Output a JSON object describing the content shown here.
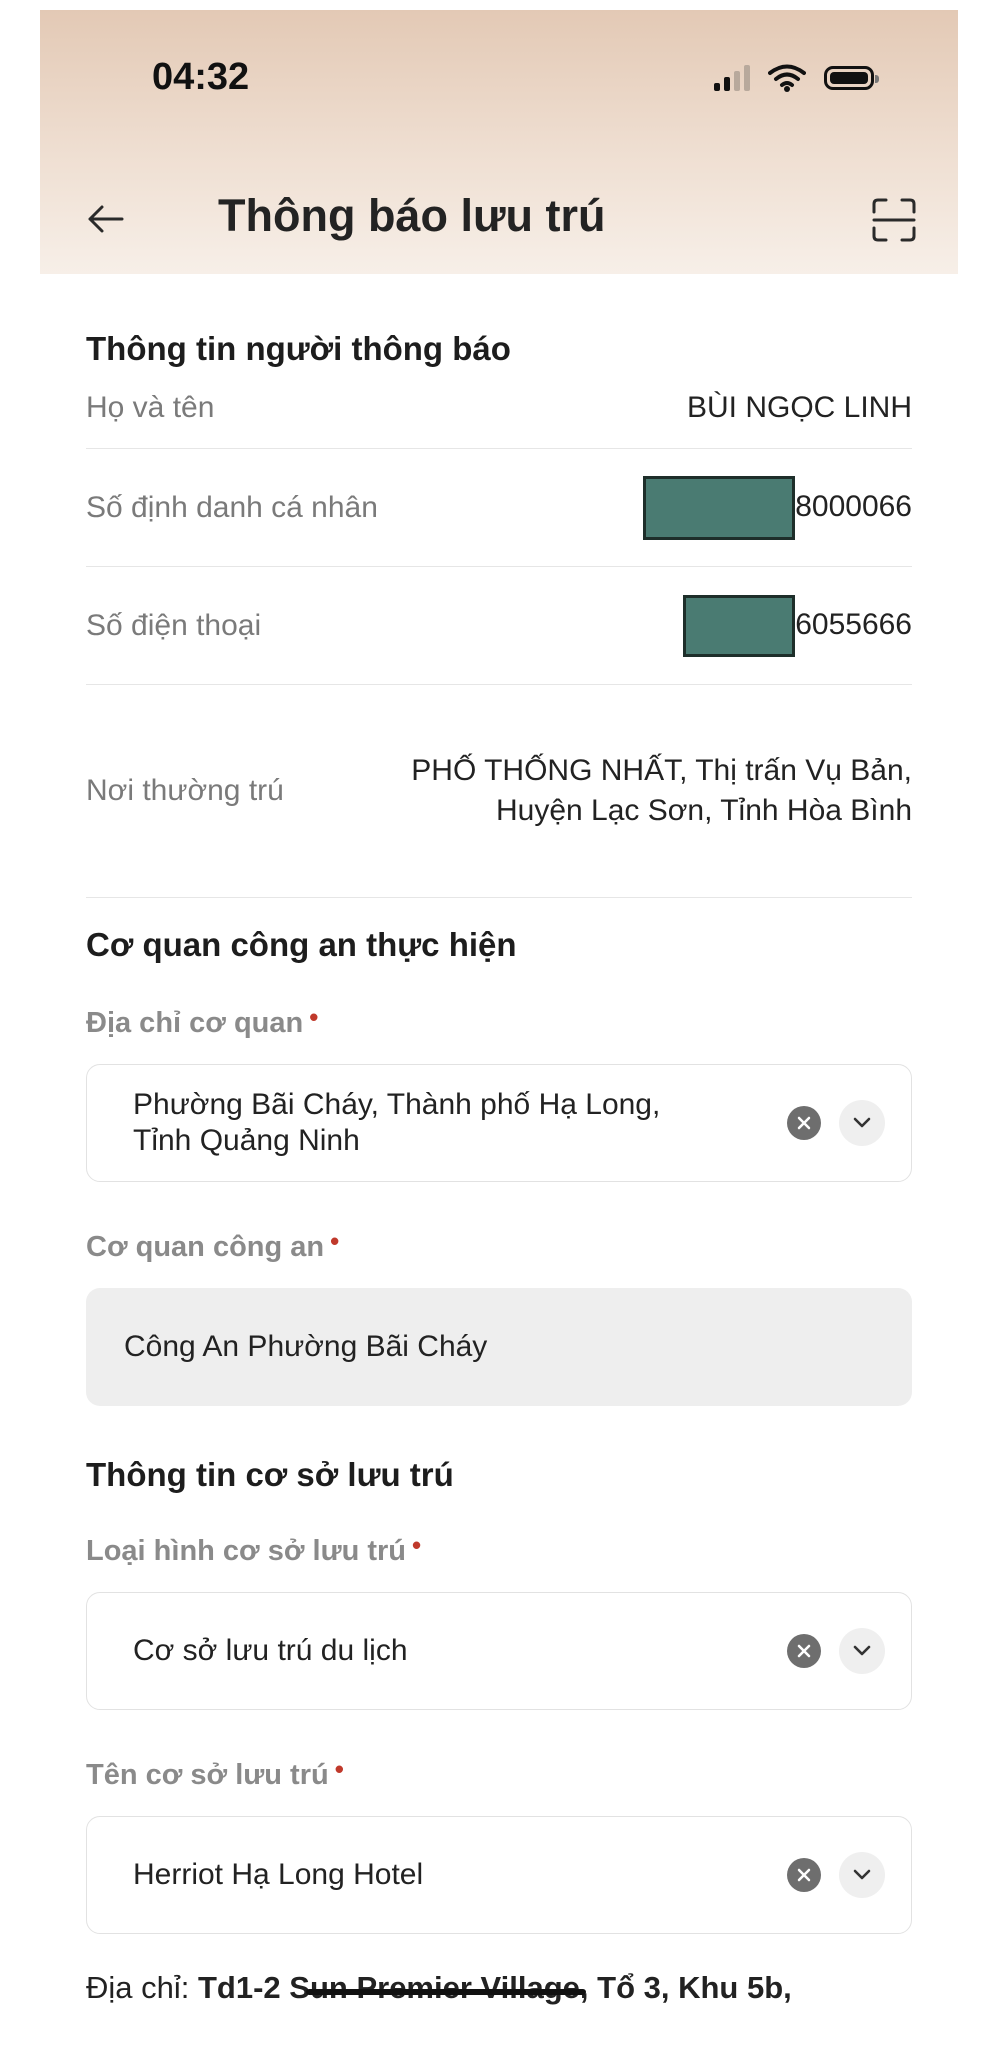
{
  "status_bar": {
    "time": "04:32"
  },
  "header": {
    "title": "Thông báo lưu trú"
  },
  "notifier": {
    "section_title": "Thông tin người thông báo",
    "rows": [
      {
        "label": "Họ và tên",
        "value": "BÙI NGỌC LINH"
      },
      {
        "label": "Số định danh cá nhân",
        "value": "8000066"
      },
      {
        "label": "Số điện thoại",
        "value": "6055666"
      },
      {
        "label": "Nơi thường trú",
        "value_line1": "PHỐ THỐNG NHẤT, Thị trấn Vụ Bản,",
        "value_line2": "Huyện Lạc Sơn, Tỉnh Hòa Bình"
      }
    ]
  },
  "police": {
    "section_title": "Cơ quan công an thực hiện",
    "address_label": "Địa chỉ cơ quan",
    "address_value_line1": "Phường Bãi Cháy, Thành phố Hạ Long,",
    "address_value_line2": "Tỉnh Quảng Ninh",
    "station_label": "Cơ quan công an",
    "station_value": "Công An Phường Bãi Cháy"
  },
  "accommodation": {
    "section_title": "Thông tin cơ sở lưu trú",
    "type_label": "Loại hình cơ sở lưu trú",
    "type_value": "Cơ sở lưu trú du lịch",
    "name_label": "Tên cơ sở lưu trú",
    "name_value": "Herriot Hạ Long Hotel",
    "address_prefix": "Địa chỉ:",
    "address_part1": "Td1-2 S",
    "address_part2": "un Premier Village",
    "address_part3": ", Tổ 3, Khu 5b,"
  },
  "required_mark": "•",
  "colors": {
    "accent_required": "#c0392b",
    "redaction": "#4a7b72",
    "header_top": "#e3c9b5"
  }
}
